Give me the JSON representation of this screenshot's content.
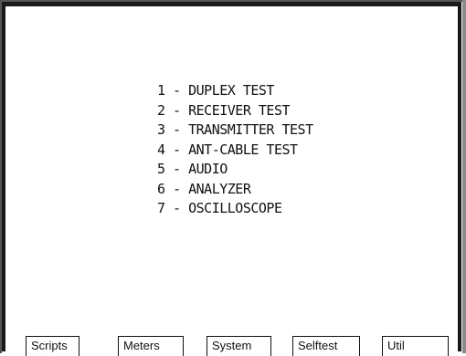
{
  "menu": {
    "items": [
      "1 - DUPLEX TEST",
      "2 - RECEIVER TEST",
      "3 - TRANSMITTER TEST",
      "4 - ANT-CABLE TEST",
      "5 - AUDIO",
      "6 - ANALYZER",
      "7 - OSCILLOSCOPE"
    ]
  },
  "softkeys": {
    "labels": [
      "Scripts",
      "Meters",
      "System",
      "Selftest",
      "Util"
    ]
  },
  "colors": {
    "background": "#ffffff",
    "frame": "#1a1a1a",
    "text": "#111111"
  }
}
